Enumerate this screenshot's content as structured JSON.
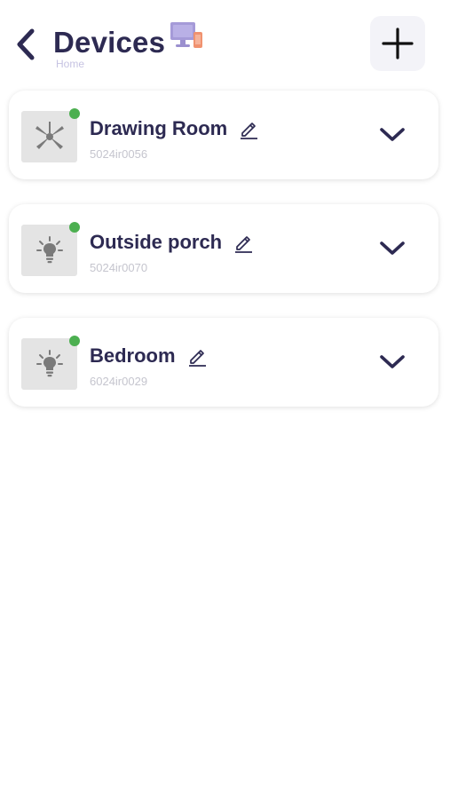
{
  "header": {
    "title": "Devices",
    "subtitle": "Home",
    "icon": "devices-icon"
  },
  "colors": {
    "title": "#2d2a52",
    "online": "#4caf50",
    "subtitle": "#c6c3e2",
    "device_id": "#c5c5ce"
  },
  "devices": [
    {
      "name": "Drawing Room",
      "id": "5024ir0056",
      "type": "fan-icon",
      "online": true
    },
    {
      "name": "Outside porch",
      "id": "5024ir0070",
      "type": "bulb-icon",
      "online": true
    },
    {
      "name": "Bedroom",
      "id": "6024ir0029",
      "type": "bulb-icon",
      "online": true
    }
  ]
}
